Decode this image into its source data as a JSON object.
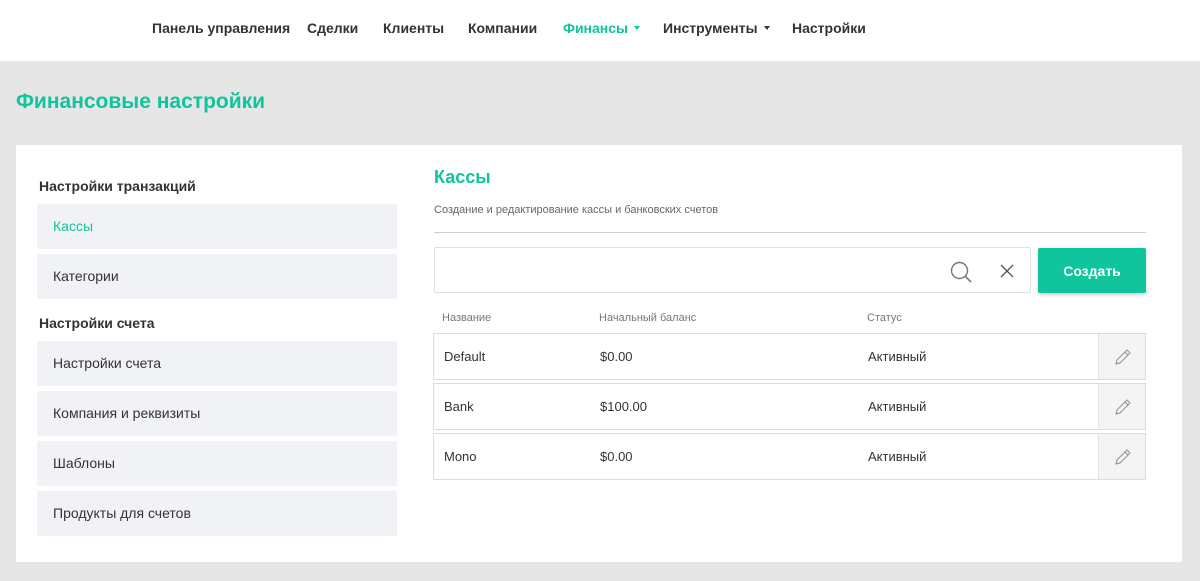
{
  "nav": {
    "items": [
      {
        "label": "Панель управления"
      },
      {
        "label": "Сделки"
      },
      {
        "label": "Клиенты"
      },
      {
        "label": "Компании"
      },
      {
        "label": "Финансы"
      },
      {
        "label": "Инструменты"
      },
      {
        "label": "Настройки"
      }
    ]
  },
  "page": {
    "title": "Финансовые настройки"
  },
  "sidebar": {
    "section1_title": "Настройки транзакций",
    "section1_items": [
      {
        "label": "Кассы"
      },
      {
        "label": "Категории"
      }
    ],
    "section2_title": "Настройки счета",
    "section2_items": [
      {
        "label": "Настройки счета"
      },
      {
        "label": "Компания и реквизиты"
      },
      {
        "label": "Шаблоны"
      },
      {
        "label": "Продукты для счетов"
      }
    ]
  },
  "main": {
    "title": "Кассы",
    "subtitle": "Создание и редактирование кассы и банковских счетов",
    "search": {
      "value": "",
      "placeholder": ""
    },
    "create_label": "Создать"
  },
  "table": {
    "columns": [
      "Название",
      "Начальный баланс",
      "Статус"
    ],
    "rows": [
      {
        "name": "Default",
        "balance": "$0.00",
        "status": "Активный"
      },
      {
        "name": "Bank",
        "balance": "$100.00",
        "status": "Активный"
      },
      {
        "name": "Mono",
        "balance": "$0.00",
        "status": "Активный"
      }
    ]
  },
  "colors": {
    "accent": "#10c49b",
    "background": "#e6e6e6",
    "sidebar_item_bg": "#f1f2f5"
  },
  "icons": {
    "search": "search-icon",
    "clear": "close-icon",
    "edit": "pencil-icon",
    "dropdown": "caret-down-icon"
  }
}
